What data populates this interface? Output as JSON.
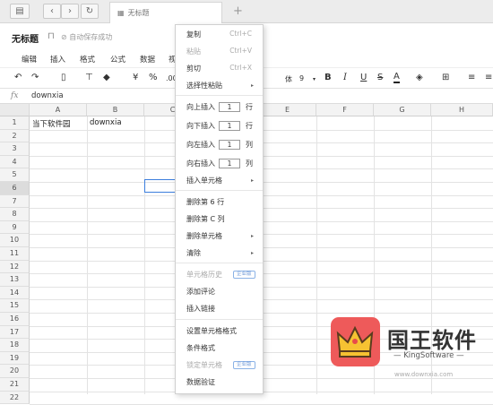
{
  "topbar": {
    "tab_title": "无标题",
    "new_tab": "+"
  },
  "title": {
    "doc_title": "无标题",
    "save_status": "自动保存成功"
  },
  "menu": [
    "编辑",
    "插入",
    "格式",
    "公式",
    "数据",
    "视"
  ],
  "toolbar": {
    "currency": "¥",
    "percent": "%",
    "decimals": ".00",
    "font_name": "体",
    "font_size": "9"
  },
  "formula_bar": {
    "fx": "fx",
    "value": "downxia"
  },
  "grid": {
    "columns": [
      "A",
      "B",
      "C",
      "D",
      "E",
      "F",
      "G",
      "H"
    ],
    "rows": [
      "1",
      "2",
      "3",
      "4",
      "5",
      "6",
      "7",
      "8",
      "9",
      "10",
      "11",
      "12",
      "13",
      "14",
      "15",
      "16",
      "17",
      "18",
      "19",
      "20",
      "21",
      "22"
    ],
    "cells": {
      "A1": "当下软件园",
      "B1": "downxia"
    },
    "selected_row": "6"
  },
  "context_menu": {
    "copy": "复制",
    "copy_sc": "Ctrl+C",
    "paste": "粘贴",
    "paste_sc": "Ctrl+V",
    "cut": "剪切",
    "cut_sc": "Ctrl+X",
    "paste_special": "选择性粘贴",
    "insert_up": "向上插入",
    "insert_down": "向下插入",
    "insert_left": "向左插入",
    "insert_right": "向右插入",
    "count": "1",
    "unit_row": "行",
    "unit_col": "列",
    "insert_cell": "插入单元格",
    "delete_row": "删除第 6 行",
    "delete_col": "删除第 C 列",
    "delete_cell": "删除单元格",
    "clear": "清除",
    "cell_history": "单元格历史",
    "badge": "企业版",
    "add_comment": "添加评论",
    "insert_link": "插入链接",
    "format_cells": "设置单元格格式",
    "conditional": "条件格式",
    "lock_cell": "锁定单元格",
    "validation": "数据验证"
  },
  "watermark": {
    "title": "国王软件",
    "subtitle": "KingSoftware",
    "url": "www.downxia.com"
  },
  "colors": {
    "selection": "#3b7ddd",
    "logo": "#ee5a5a",
    "badge": "#6a96d6"
  }
}
